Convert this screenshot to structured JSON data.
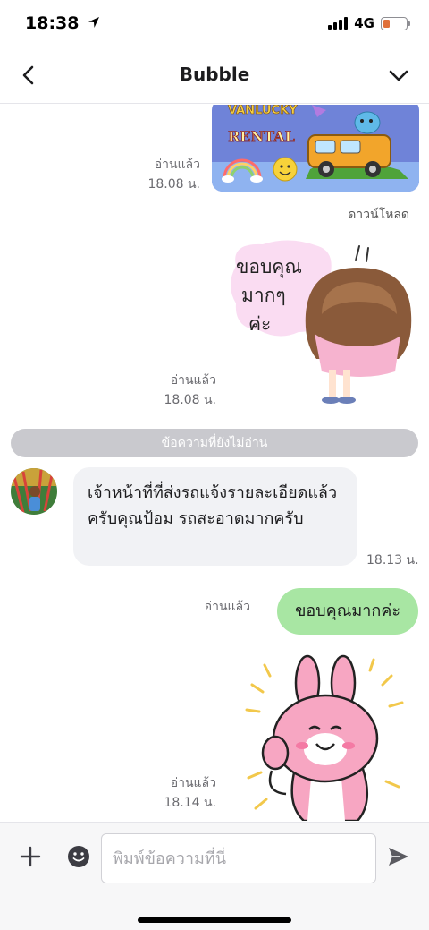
{
  "status": {
    "time": "18:38",
    "network": "4G",
    "battery_level": 0.3,
    "icons": [
      "location-arrow-icon",
      "signal-bars-icon",
      "battery-icon"
    ]
  },
  "nav": {
    "title": "Bubble",
    "back_icon": "chevron-left-icon",
    "menu_icon": "chevron-down-icon"
  },
  "messages": {
    "image_card": {
      "text": "VANLUCKY RENTAL",
      "read_label": "อ่านแล้ว",
      "time": "18.08 น.",
      "download_label": "ดาวน์โหลด"
    },
    "sticker_thanks": {
      "text": "ขอบคุณ มากๆ ค่ะ",
      "read_label": "อ่านแล้ว",
      "time": "18.08 น."
    },
    "unread_divider": "ข้อความที่ยังไม่อ่าน",
    "incoming": {
      "text": "เจ้าหน้าที่ที่ส่งรถแจ้งรายละเอียดแล้วครับคุณป้อม รถสะอาดมากครับ",
      "time": "18.13 น."
    },
    "outgoing": {
      "text": "ขอบคุณมากค่ะ",
      "read_label": "อ่านแล้ว"
    },
    "sticker_bunny": {
      "read_label": "อ่านแล้ว",
      "time": "18.14 น."
    }
  },
  "composer": {
    "placeholder": "พิมพ์ข้อความที่นี่",
    "value": "",
    "icons": [
      "plus-icon",
      "emoji-icon",
      "send-icon"
    ]
  },
  "colors": {
    "outgoing_bubble": "#a8e6a3",
    "incoming_bubble": "#f1f2f5",
    "divider": "#c9c9ce"
  }
}
